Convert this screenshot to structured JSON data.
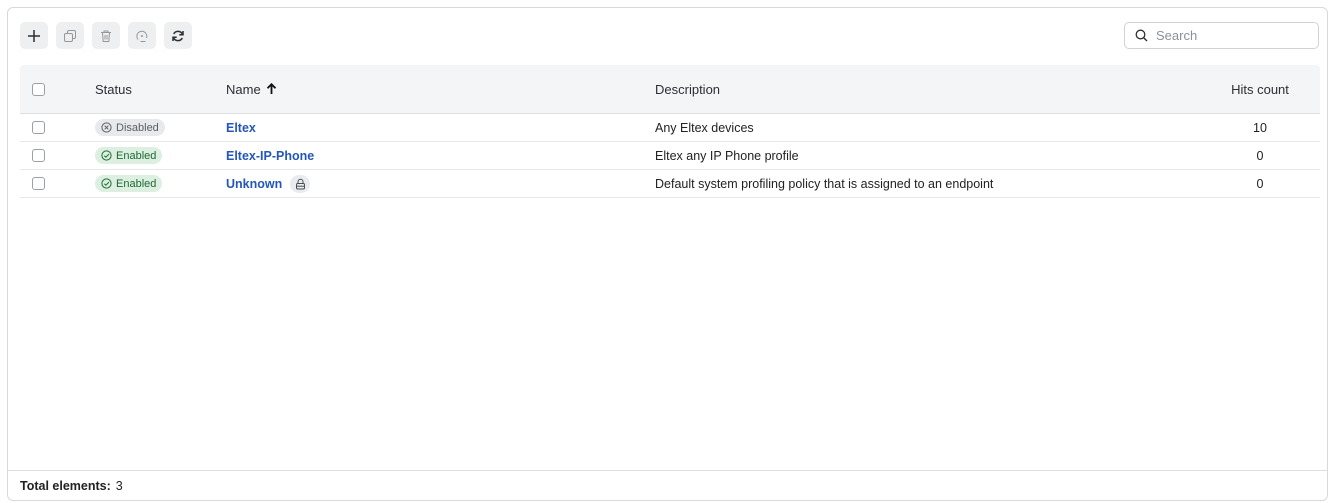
{
  "toolbar": {
    "buttons": [
      {
        "icon": "plus-icon",
        "enabled": true
      },
      {
        "icon": "copy-icon",
        "enabled": false
      },
      {
        "icon": "trash-icon",
        "enabled": false
      },
      {
        "icon": "reset-icon",
        "enabled": false
      },
      {
        "icon": "refresh-icon",
        "enabled": true
      }
    ]
  },
  "search": {
    "placeholder": "Search",
    "value": ""
  },
  "table": {
    "columns": {
      "status": "Status",
      "name": "Name",
      "name_sort": "ascending",
      "description": "Description",
      "hits": "Hits count"
    },
    "rows": [
      {
        "status": "Disabled",
        "name": "Eltex",
        "locked": false,
        "description": "Any Eltex devices",
        "hits": "10"
      },
      {
        "status": "Enabled",
        "name": "Eltex-IP-Phone",
        "locked": false,
        "description": "Eltex any IP Phone profile",
        "hits": "0"
      },
      {
        "status": "Enabled",
        "name": "Unknown",
        "locked": true,
        "description": "Default system profiling policy that is assigned to an endpoint",
        "hits": "0"
      }
    ]
  },
  "footer": {
    "total_label": "Total elements:",
    "total_value": "3"
  },
  "colors": {
    "enabled_bg": "#dcefe0",
    "enabled_text": "#1d6b33",
    "disabled_bg": "#e7e9ec",
    "link": "#2457b8"
  }
}
